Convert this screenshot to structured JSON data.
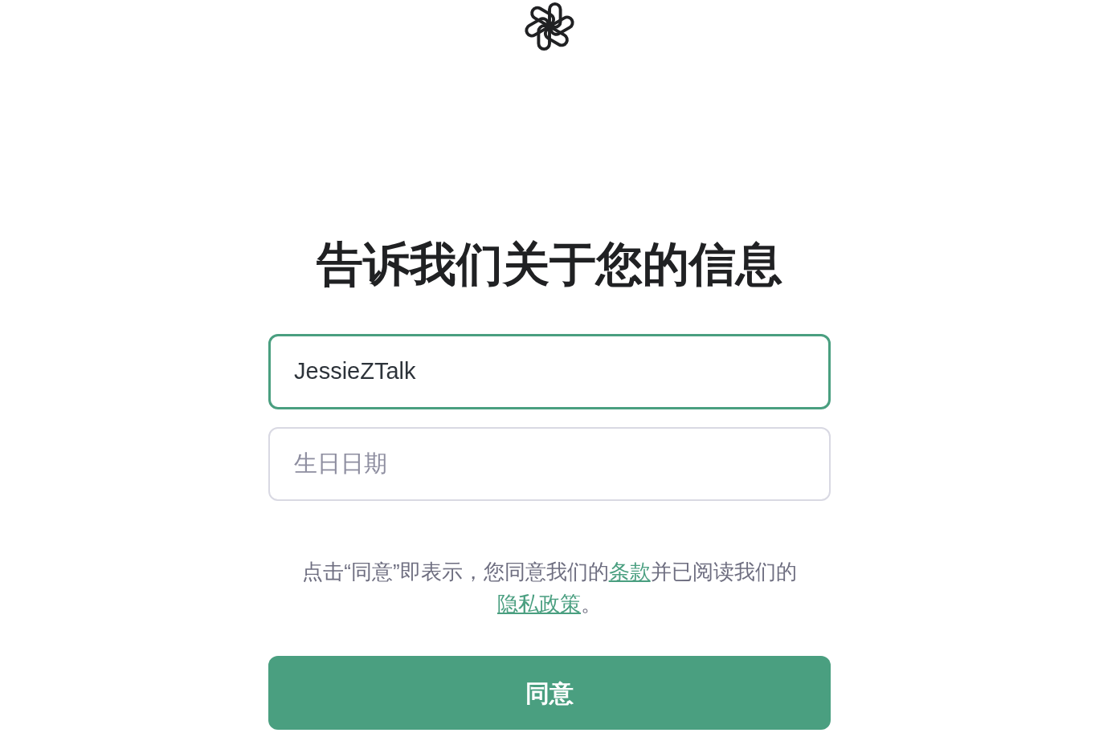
{
  "heading": "告诉我们关于您的信息",
  "fields": [
    {
      "value": "JessieZTalk",
      "focused": true
    },
    {
      "placeholder": "生日日期",
      "focused": false
    }
  ],
  "consent": [
    {
      "kind": "text",
      "text": "点击“同意”即表示，您同意我们的"
    },
    {
      "kind": "link",
      "text": "条款"
    },
    {
      "kind": "text",
      "text": "并已阅读我们的"
    },
    {
      "kind": "link",
      "text": "隐私政策"
    },
    {
      "kind": "text",
      "text": "。"
    }
  ],
  "button": "同意"
}
